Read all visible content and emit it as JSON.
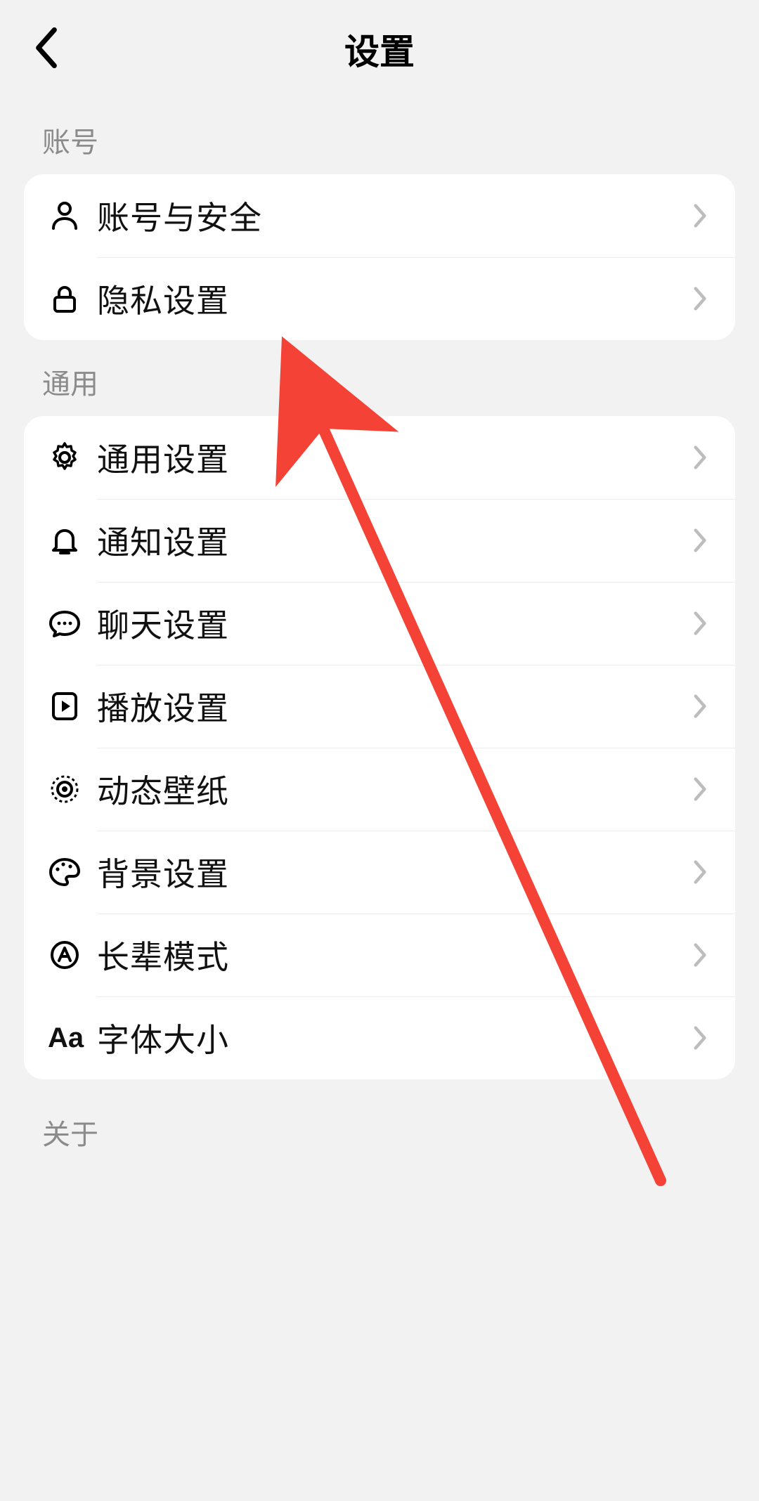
{
  "header": {
    "title": "设置"
  },
  "sections": {
    "account": {
      "label": "账号",
      "items": [
        {
          "label": "账号与安全"
        },
        {
          "label": "隐私设置"
        }
      ]
    },
    "general": {
      "label": "通用",
      "items": [
        {
          "label": "通用设置"
        },
        {
          "label": "通知设置"
        },
        {
          "label": "聊天设置"
        },
        {
          "label": "播放设置"
        },
        {
          "label": "动态壁纸"
        },
        {
          "label": "背景设置"
        },
        {
          "label": "长辈模式"
        },
        {
          "label": "字体大小"
        }
      ]
    },
    "about": {
      "label": "关于"
    }
  },
  "colors": {
    "bg": "#f2f2f2",
    "card": "#ffffff",
    "text": "#111111",
    "secondary": "#8b8b8b",
    "chevron": "#bdbdbd",
    "arrow": "#f44336"
  }
}
